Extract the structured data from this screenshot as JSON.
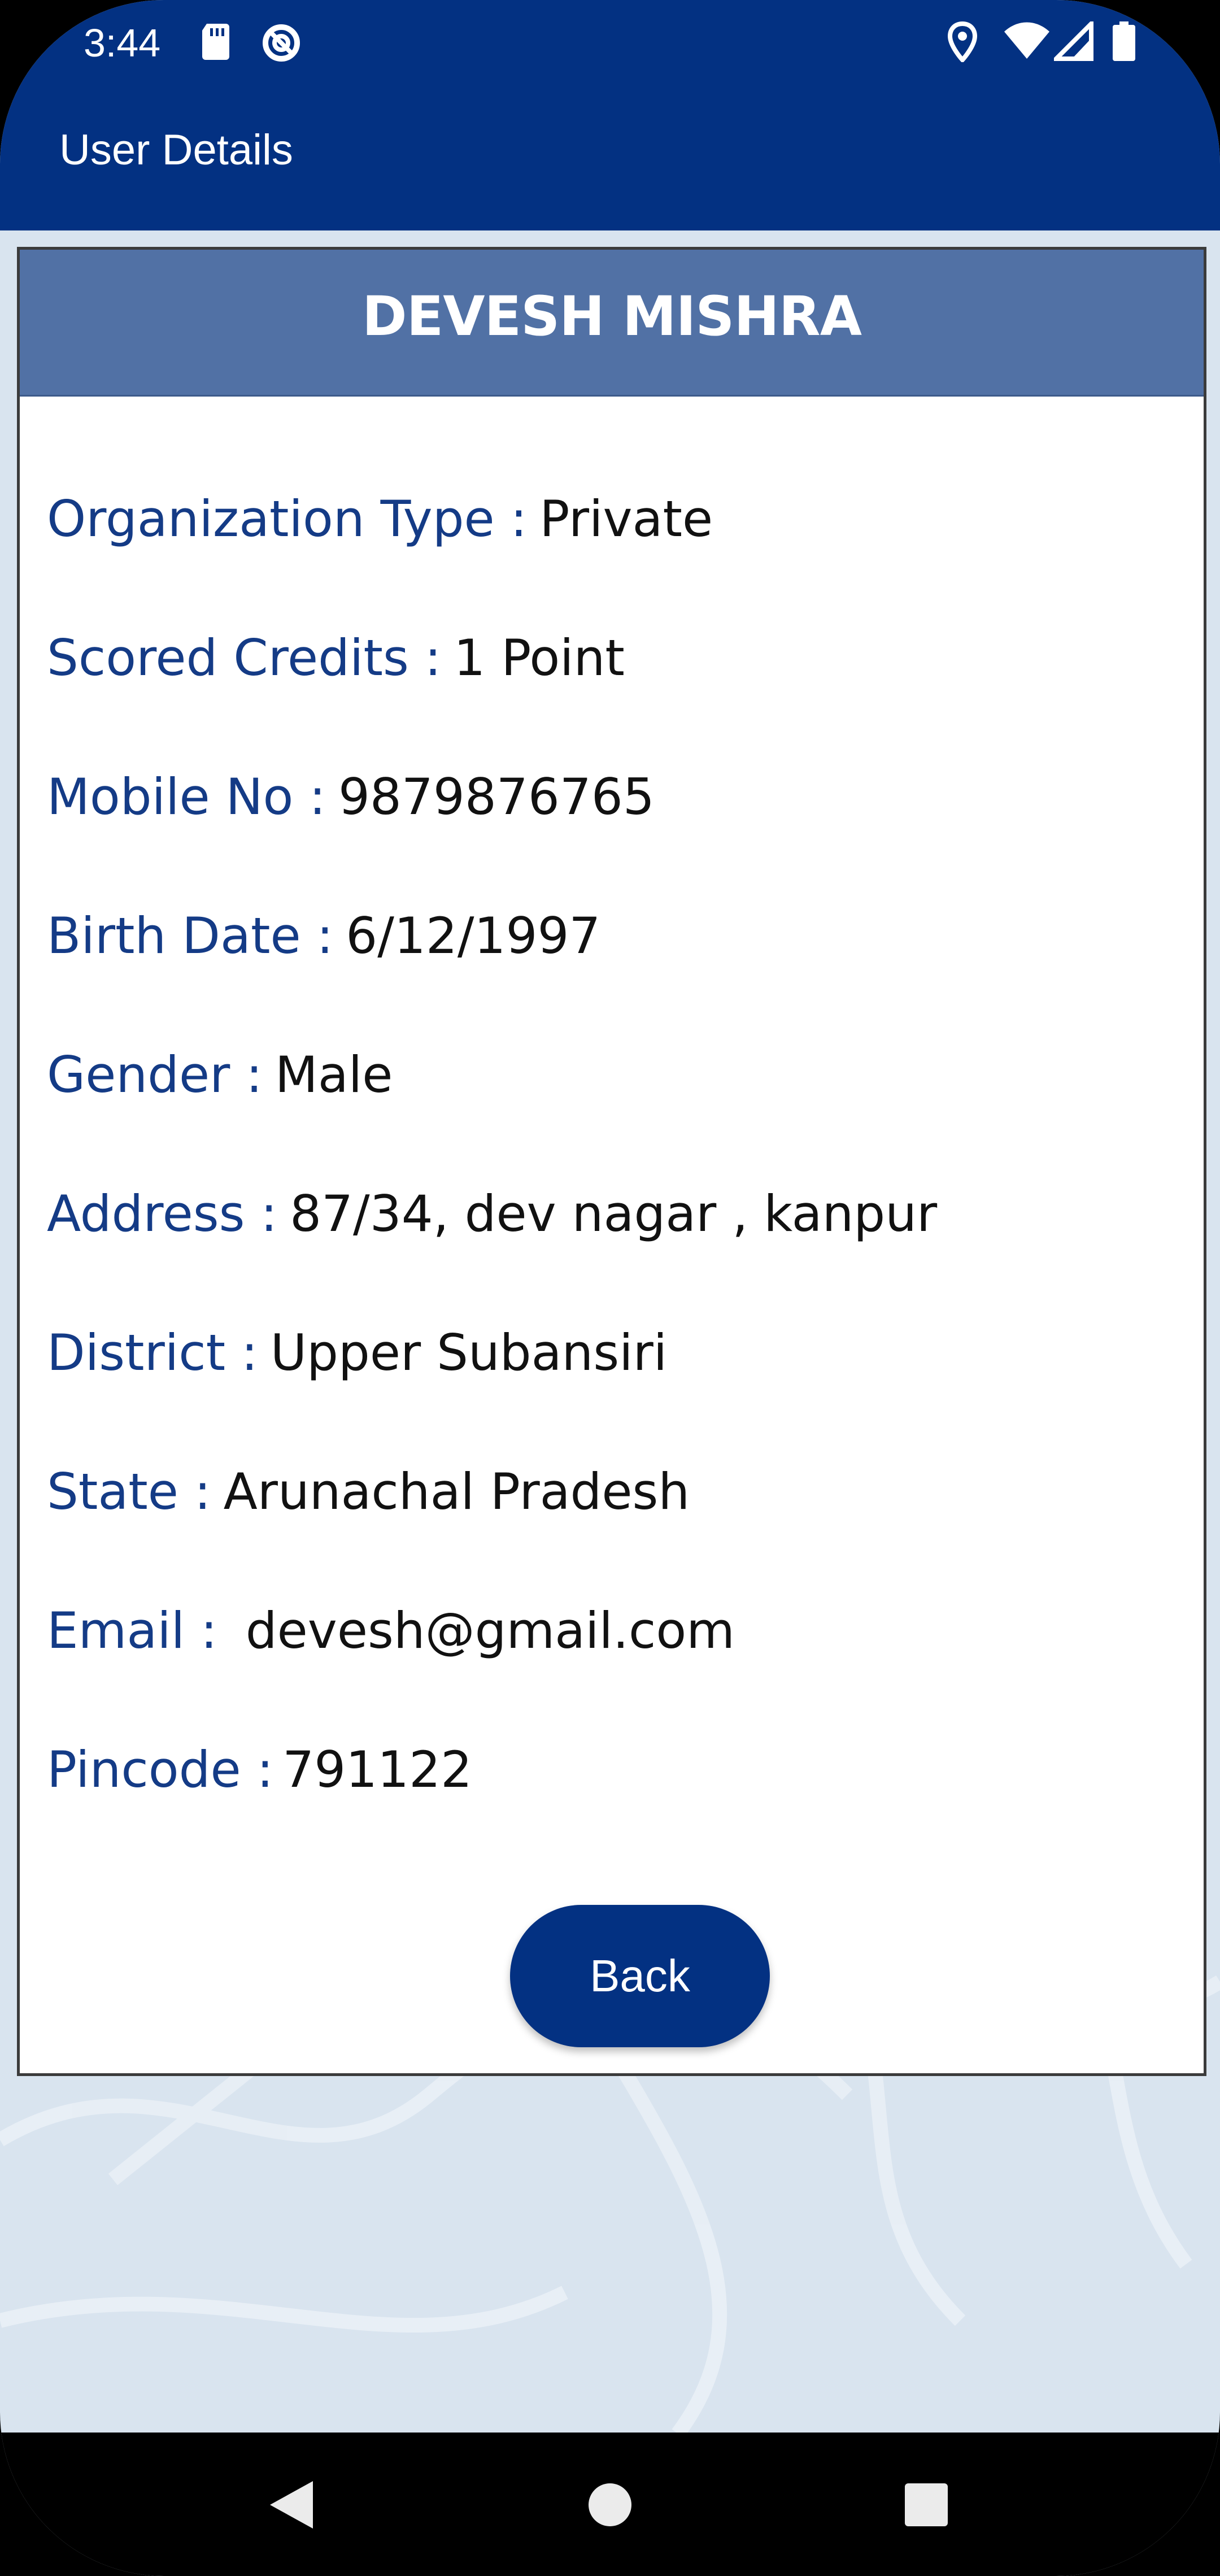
{
  "status_bar": {
    "time": "3:44",
    "icons": [
      "sd-card-icon",
      "data-saver-icon",
      "location-icon",
      "wifi-icon",
      "signal-icon",
      "battery-icon"
    ]
  },
  "app_bar": {
    "title": "User Details"
  },
  "card": {
    "name": "DEVESH MISHRA",
    "details": [
      {
        "label": "Organization Type :",
        "value": "Private"
      },
      {
        "label": "Scored Credits :",
        "value": "1 Point"
      },
      {
        "label": "Mobile No :",
        "value": "9879876765"
      },
      {
        "label": "Birth Date :",
        "value": "6/12/1997"
      },
      {
        "label": "Gender :",
        "value": "Male"
      },
      {
        "label": "Address :",
        "value": "87/34, dev nagar , kanpur"
      },
      {
        "label": "District :",
        "value": "Upper Subansiri"
      },
      {
        "label": "State :",
        "value": "Arunachal Pradesh"
      },
      {
        "label": "Email :",
        "value": " devesh@gmail.com"
      },
      {
        "label": "Pincode :",
        "value": "791122"
      }
    ],
    "back_label": "Back"
  },
  "nav_bar": {
    "buttons": [
      "back-triangle-icon",
      "home-circle-icon",
      "recents-square-icon"
    ]
  },
  "colors": {
    "primary": "#033182",
    "header": "#5171a5",
    "label": "#143b86",
    "background": "#d9e4ef"
  }
}
